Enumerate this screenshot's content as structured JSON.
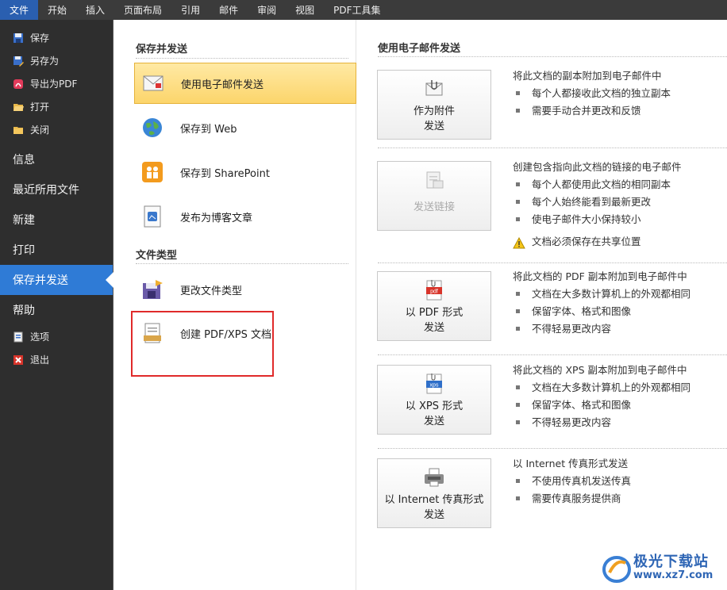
{
  "tabs": [
    {
      "label": "文件",
      "active": true
    },
    {
      "label": "开始"
    },
    {
      "label": "插入"
    },
    {
      "label": "页面布局"
    },
    {
      "label": "引用"
    },
    {
      "label": "邮件"
    },
    {
      "label": "审阅"
    },
    {
      "label": "视图"
    },
    {
      "label": "PDF工具集"
    }
  ],
  "sidebar": {
    "small_top": [
      {
        "label": "保存",
        "icon": "save-icon"
      },
      {
        "label": "另存为",
        "icon": "save-as-icon"
      },
      {
        "label": "导出为PDF",
        "icon": "export-pdf-icon"
      },
      {
        "label": "打开",
        "icon": "open-folder-icon"
      },
      {
        "label": "关闭",
        "icon": "close-folder-icon"
      }
    ],
    "big": [
      {
        "label": "信息"
      },
      {
        "label": "最近所用文件"
      },
      {
        "label": "新建"
      },
      {
        "label": "打印"
      },
      {
        "label": "保存并发送",
        "active": true
      },
      {
        "label": "帮助"
      }
    ],
    "small_bottom": [
      {
        "label": "选项",
        "icon": "options-icon"
      },
      {
        "label": "退出",
        "icon": "exit-icon"
      }
    ]
  },
  "mid": {
    "section1_title": "保存并发送",
    "section1_items": [
      {
        "label": "使用电子邮件发送",
        "icon": "email-icon",
        "selected": true
      },
      {
        "label": "保存到 Web",
        "icon": "globe-icon"
      },
      {
        "label": "保存到 SharePoint",
        "icon": "sharepoint-icon"
      },
      {
        "label": "发布为博客文章",
        "icon": "blog-icon"
      }
    ],
    "section2_title": "文件类型",
    "section2_items": [
      {
        "label": "更改文件类型",
        "icon": "change-filetype-icon"
      },
      {
        "label": "创建 PDF/XPS 文档",
        "icon": "pdf-xps-doc-icon"
      }
    ]
  },
  "right": {
    "title": "使用电子邮件发送",
    "options": [
      {
        "button": [
          "作为附件",
          "发送"
        ],
        "icon": "attachment-icon",
        "disabled": false,
        "heading": "将此文档的副本附加到电子邮件中",
        "bullets": [
          "每个人都接收此文档的独立副本",
          "需要手动合并更改和反馈"
        ]
      },
      {
        "button": [
          "发送链接"
        ],
        "icon": "send-link-icon",
        "disabled": true,
        "heading": "创建包含指向此文档的链接的电子邮件",
        "bullets": [
          "每个人都使用此文档的相同副本",
          "每个人始终能看到最新更改",
          "使电子邮件大小保持较小"
        ],
        "warning": "文档必须保存在共享位置"
      },
      {
        "button": [
          "以 PDF 形式",
          "发送"
        ],
        "icon": "pdf-icon",
        "disabled": false,
        "heading": "将此文档的 PDF 副本附加到电子邮件中",
        "bullets": [
          "文档在大多数计算机上的外观都相同",
          "保留字体、格式和图像",
          "不得轻易更改内容"
        ]
      },
      {
        "button": [
          "以 XPS 形式",
          "发送"
        ],
        "icon": "xps-icon",
        "disabled": false,
        "heading": "将此文档的 XPS 副本附加到电子邮件中",
        "bullets": [
          "文档在大多数计算机上的外观都相同",
          "保留字体、格式和图像",
          "不得轻易更改内容"
        ]
      },
      {
        "button": [
          "以 Internet 传真形式",
          "发送"
        ],
        "icon": "fax-icon",
        "disabled": false,
        "heading": "以 Internet 传真形式发送",
        "bullets": [
          "不使用传真机发送传真",
          "需要传真服务提供商"
        ]
      }
    ]
  },
  "watermark": {
    "title": "极光下载站",
    "url": "www.xz7.com"
  }
}
